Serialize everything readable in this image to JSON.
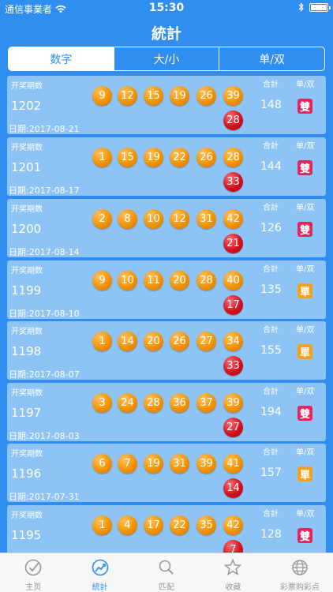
{
  "status_bar": {
    "carrier": "通信事業者",
    "time": "15:30"
  },
  "nav": {
    "title": "統計"
  },
  "segments": [
    "数字",
    "大/小",
    "单/双"
  ],
  "card_labels": {
    "period": "开奖期数",
    "sum": "合計",
    "odd_even": "单/双",
    "date_prefix": "日期:"
  },
  "draws": [
    {
      "period": "1202",
      "date": "2017-08-21",
      "numbers": [
        "9",
        "12",
        "15",
        "19",
        "26",
        "39"
      ],
      "special": "28",
      "sum": "148",
      "odd_even": "雙",
      "odd_even_color": "#e5245e"
    },
    {
      "period": "1201",
      "date": "2017-08-17",
      "numbers": [
        "1",
        "15",
        "19",
        "22",
        "26",
        "28"
      ],
      "special": "33",
      "sum": "144",
      "odd_even": "雙",
      "odd_even_color": "#e5245e"
    },
    {
      "period": "1200",
      "date": "2017-08-14",
      "numbers": [
        "2",
        "8",
        "10",
        "12",
        "31",
        "42"
      ],
      "special": "21",
      "sum": "126",
      "odd_even": "雙",
      "odd_even_color": "#e5245e"
    },
    {
      "period": "1199",
      "date": "2017-08-10",
      "numbers": [
        "9",
        "10",
        "11",
        "20",
        "28",
        "40"
      ],
      "special": "17",
      "sum": "135",
      "odd_even": "單",
      "odd_even_color": "#f2a11a"
    },
    {
      "period": "1198",
      "date": "2017-08-07",
      "numbers": [
        "1",
        "14",
        "20",
        "26",
        "27",
        "34"
      ],
      "special": "33",
      "sum": "155",
      "odd_even": "單",
      "odd_even_color": "#f2a11a"
    },
    {
      "period": "1197",
      "date": "2017-08-03",
      "numbers": [
        "3",
        "24",
        "28",
        "36",
        "37",
        "39"
      ],
      "special": "27",
      "sum": "194",
      "odd_even": "雙",
      "odd_even_color": "#e5245e"
    },
    {
      "period": "1196",
      "date": "2017-07-31",
      "numbers": [
        "6",
        "7",
        "19",
        "31",
        "39",
        "41"
      ],
      "special": "14",
      "sum": "157",
      "odd_even": "單",
      "odd_even_color": "#f2a11a"
    },
    {
      "period": "1195",
      "date": "",
      "numbers": [
        "1",
        "4",
        "17",
        "22",
        "35",
        "42"
      ],
      "special": "7",
      "sum": "128",
      "odd_even": "雙",
      "odd_even_color": "#e5245e"
    }
  ],
  "tabs": [
    {
      "label": "主页",
      "icon": "check-circle-icon"
    },
    {
      "label": "統計",
      "icon": "trend-chart-icon"
    },
    {
      "label": "匹配",
      "icon": "search-icon"
    },
    {
      "label": "收藏",
      "icon": "star-icon"
    },
    {
      "label": "彩票购彩点",
      "icon": "globe-icon"
    }
  ],
  "colors": {
    "background": "#2f8ef0",
    "card": "#8ec3f5",
    "ball_orange": "#f29300",
    "ball_red": "#d3111d",
    "active_tab": "#2f8ef0"
  }
}
